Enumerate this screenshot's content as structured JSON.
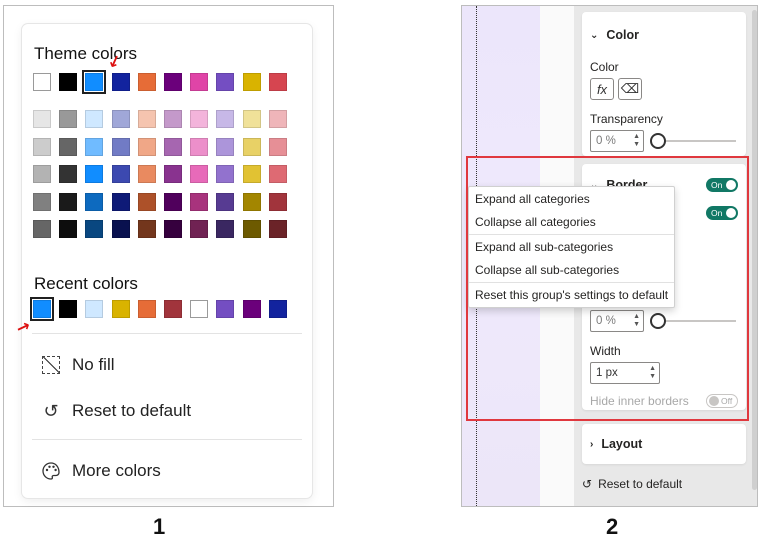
{
  "panel1": {
    "theme_title": "Theme colors",
    "recent_title": "Recent colors",
    "theme_top_row": [
      "#ffffff",
      "#000000",
      "#118dff",
      "#12239e",
      "#e66c37",
      "#6b007b",
      "#e044a7",
      "#744ec2",
      "#d9b300",
      "#d64550"
    ],
    "theme_shades": [
      [
        "#e6e6e6",
        "#999999",
        "#cfe8ff",
        "#a0a7d8",
        "#f5c4af",
        "#c499ca",
        "#f3b4db",
        "#c7b8e7",
        "#f0e199",
        "#efb5b9"
      ],
      [
        "#cccccc",
        "#666666",
        "#70bbff",
        "#717bc5",
        "#f0a787",
        "#a666b0",
        "#ec8fca",
        "#ac95da",
        "#e8d166",
        "#e68f96"
      ],
      [
        "#b3b3b3",
        "#333333",
        "#118dff",
        "#3c49b0",
        "#e98a60",
        "#89338f",
        "#e76ab9",
        "#9272ce",
        "#e1c233",
        "#de6a73"
      ],
      [
        "#808080",
        "#1a1a1a",
        "#0d6abf",
        "#0e1a77",
        "#ad5129",
        "#50005c",
        "#a8337d",
        "#573b92",
        "#a38600",
        "#a1343c"
      ],
      [
        "#666666",
        "#0d0d0d",
        "#094780",
        "#09114f",
        "#73361c",
        "#36003e",
        "#702253",
        "#3a2761",
        "#6d5a00",
        "#6b2328"
      ]
    ],
    "recent_colors": [
      "#118dff",
      "#000000",
      "#cfe8ff",
      "#d9b300",
      "#e66c37",
      "#a1343c",
      "#ffffff",
      "#744ec2",
      "#6b007b",
      "#12239e"
    ],
    "menu": {
      "no_fill": "No fill",
      "reset": "Reset to default",
      "more_colors": "More colors"
    },
    "number": "1"
  },
  "panel2": {
    "color_header": "Color",
    "color_label": "Color",
    "fx_label": "fx",
    "transparency_label": "Transparency",
    "transparency_value": "0 %",
    "transparency_level": 0,
    "border_header": "Border",
    "border_toggle": "On",
    "second_toggle": "On",
    "border_transparency_value": "0 %",
    "width_label": "Width",
    "width_value": "1 px",
    "hide_inner_label": "Hide inner borders",
    "hide_inner_toggle": "Off",
    "layout_header": "Layout",
    "reset_label": "Reset to default",
    "context_menu": {
      "expand_all": "Expand all categories",
      "collapse_all": "Collapse all categories",
      "expand_sub": "Expand all sub-categories",
      "collapse_sub": "Collapse all sub-categories",
      "reset_group": "Reset this group's settings to default"
    },
    "number": "2"
  },
  "colors": {
    "accent_toggle": "#117865",
    "highlight_box": "#e0383e",
    "annotation_arrow": "#dd1111"
  },
  "icons": [
    "no-fill-icon",
    "reset-icon",
    "palette-icon",
    "chevron-down-icon",
    "chevron-right-icon",
    "fx-icon",
    "eraser-icon"
  ]
}
